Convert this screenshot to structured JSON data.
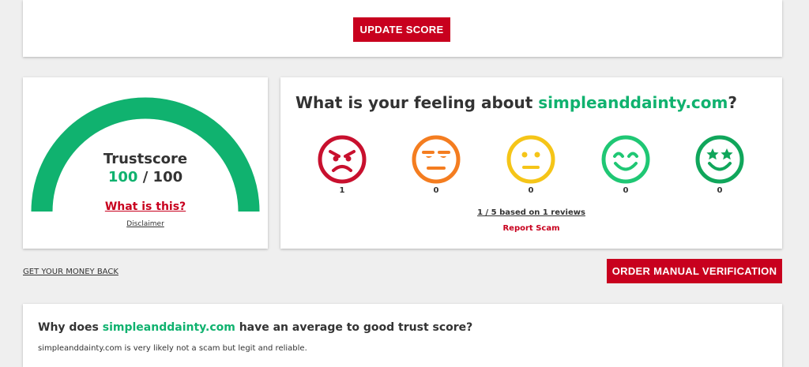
{
  "top": {
    "update_label": "UPDATE SCORE"
  },
  "trust": {
    "label": "Trustscore",
    "score": "100",
    "separator": " / ",
    "max": "100",
    "level": 1.0,
    "what_label": "What is this?",
    "disclaimer_label": "Disclaimer"
  },
  "feeling": {
    "title_prefix": "What is your feeling about ",
    "site": "simpleanddainty.com",
    "title_suffix": "?",
    "emojis": [
      {
        "icon": "angry-face-icon",
        "count": "1",
        "color": "#c8102e"
      },
      {
        "icon": "annoyed-face-icon",
        "count": "0",
        "color": "#f47d20"
      },
      {
        "icon": "neutral-face-icon",
        "count": "0",
        "color": "#f5c518"
      },
      {
        "icon": "smiling-face-icon",
        "count": "0",
        "color": "#1fc774"
      },
      {
        "icon": "star-eyes-face-icon",
        "count": "0",
        "color": "#10a65b"
      }
    ],
    "based_label": "1 / 5 based on 1 reviews",
    "report_label": "Report Scam"
  },
  "actions": {
    "money_back_label": "GET YOUR MONEY BACK",
    "order_label": "ORDER MANUAL VERIFICATION"
  },
  "why": {
    "title_prefix": "Why does ",
    "site": "simpleanddainty.com",
    "title_suffix": " have an average to good trust score?",
    "text": "simpleanddainty.com is very likely not a scam but legit and reliable."
  },
  "colors": {
    "accent_red": "#c8001e",
    "trust_green": "#10b26f",
    "background": "#efefef"
  }
}
